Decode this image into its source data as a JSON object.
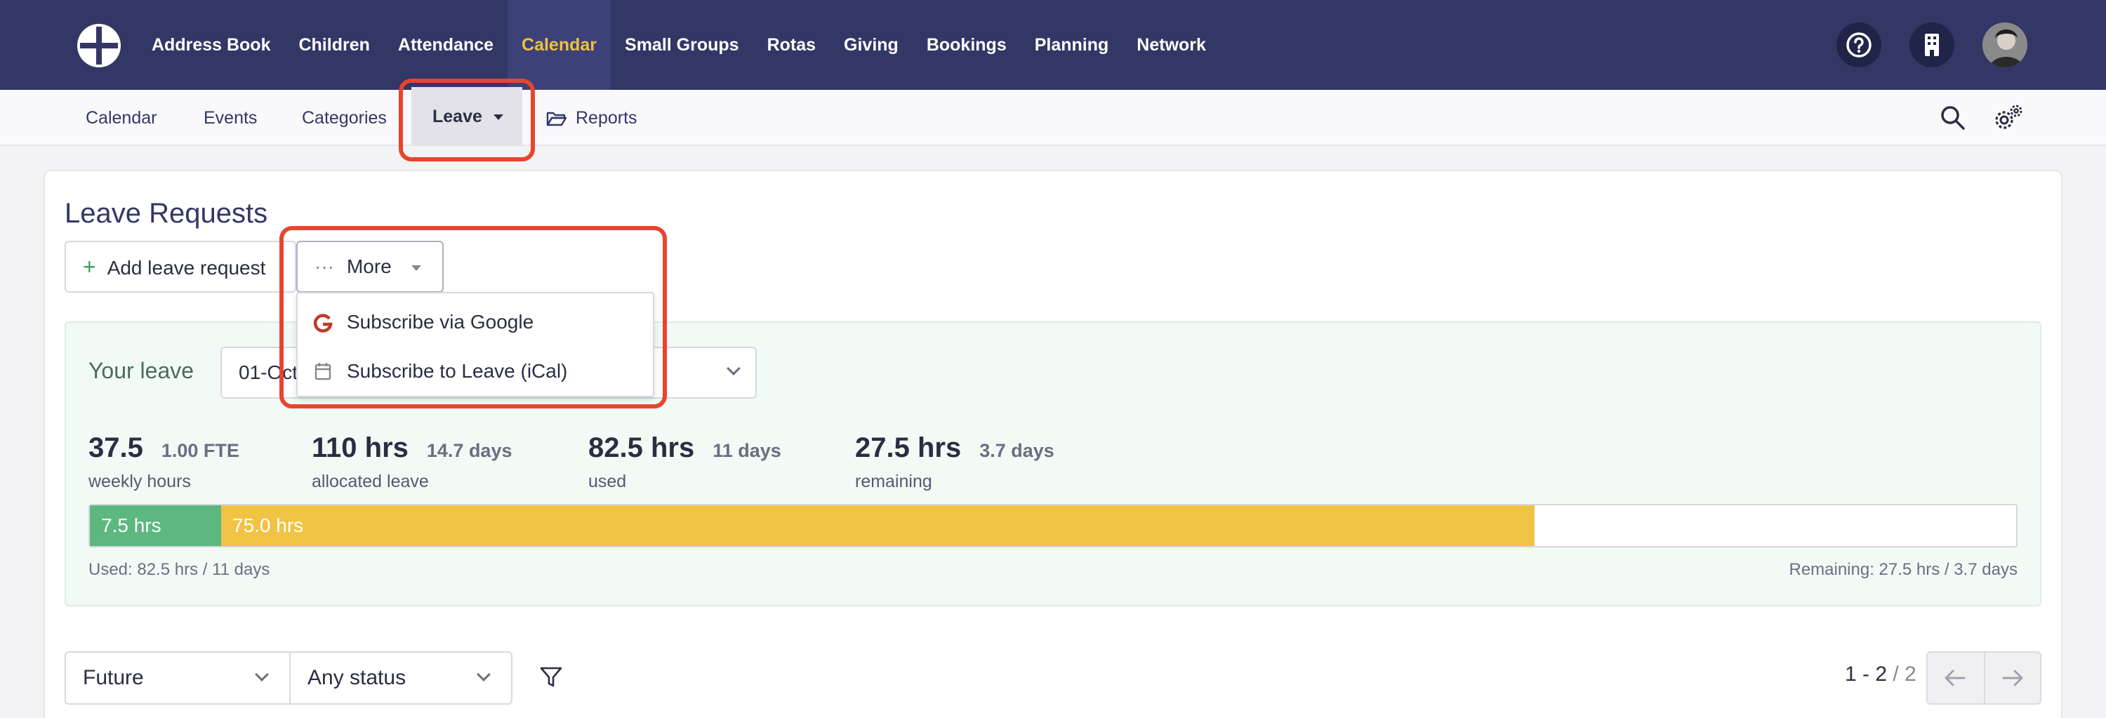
{
  "topnav": {
    "items": [
      "Address Book",
      "Children",
      "Attendance",
      "Calendar",
      "Small Groups",
      "Rotas",
      "Giving",
      "Bookings",
      "Planning",
      "Network"
    ],
    "active": "Calendar"
  },
  "subnav": {
    "items": [
      "Calendar",
      "Events",
      "Categories"
    ],
    "leave_label": "Leave",
    "reports_label": "Reports"
  },
  "page": {
    "title": "Leave Requests",
    "add_label": "Add leave request",
    "more_label": "More",
    "dropdown": [
      "Subscribe via Google",
      "Subscribe to Leave (iCal)"
    ]
  },
  "leave": {
    "label": "Your leave",
    "period": "01-Oct",
    "stats": [
      {
        "big": "37.5",
        "small": "1.00 FTE",
        "label": "weekly hours"
      },
      {
        "big": "110 hrs",
        "small": "14.7 days",
        "label": "allocated leave"
      },
      {
        "big": "82.5 hrs",
        "small": "11 days",
        "label": "used"
      },
      {
        "big": "27.5 hrs",
        "small": "3.7 days",
        "label": "remaining"
      }
    ],
    "bar": {
      "total_hrs": 110,
      "segments": [
        {
          "label": "7.5 hrs",
          "hours": 7.5,
          "color": "#5cb87f"
        },
        {
          "label": "75.0 hrs",
          "hours": 75.0,
          "color": "#f0c344"
        }
      ]
    },
    "used_note": "Used: 82.5 hrs / 11 days",
    "remaining_note": "Remaining: 27.5 hrs / 3.7 days"
  },
  "filters": {
    "time": "Future",
    "status": "Any status",
    "page_range": "1 - 2",
    "page_total": "/ 2"
  },
  "colors": {
    "nav_bg": "#323766",
    "active_text": "#f0c040",
    "highlight": "#e8442e"
  }
}
